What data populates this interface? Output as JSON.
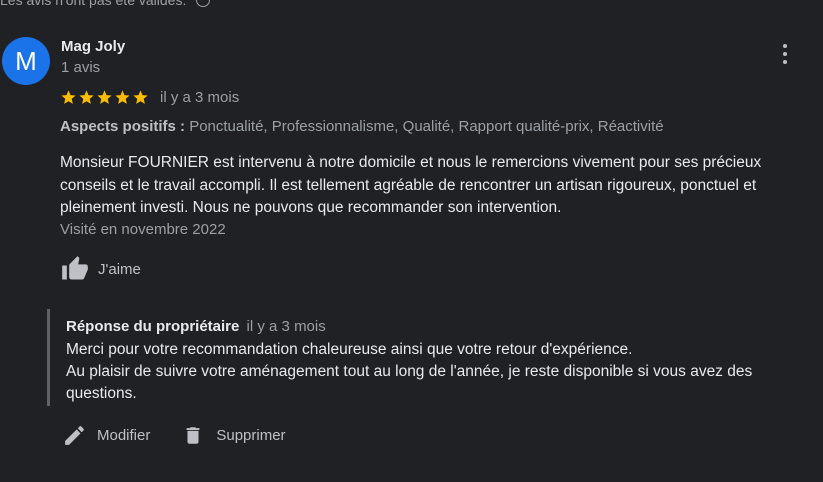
{
  "header_note": {
    "text": "Les avis n'ont pas été validés."
  },
  "review": {
    "author": {
      "initial": "M",
      "name": "Mag Joly",
      "meta": "1 avis",
      "avatar_color": "#1a73e8"
    },
    "rating": 5,
    "rating_max": 5,
    "date": "il y a 3 mois",
    "aspects": {
      "label": "Aspects positifs :",
      "values": "Ponctualité, Professionnalisme, Qualité, Rapport qualité-prix, Réactivité"
    },
    "text": "Monsieur FOURNIER est intervenu à notre domicile et nous le remercions vivement pour ses précieux conseils et le travail accompli. Il est tellement agréable de rencontrer un artisan rigoureux, ponctuel et pleinement investi. Nous ne pouvons que recommander son intervention.",
    "visited": "Visité en novembre 2022",
    "like_label": "J'aime"
  },
  "owner_reply": {
    "author": "Réponse du propriétaire",
    "date": "il y a 3 mois",
    "text_line1": "Merci pour votre recommandation chaleureuse ainsi que votre retour d'expérience.",
    "text_line2": "Au plaisir de suivre votre aménagement tout au long de l'année, je reste disponible si vous avez des questions."
  },
  "actions": {
    "edit_label": "Modifier",
    "delete_label": "Supprimer"
  },
  "icons": {
    "star": "star-icon",
    "like": "thumb-up-icon",
    "more": "more-vert-icon",
    "edit": "pencil-icon",
    "delete": "trash-icon",
    "info": "info-icon"
  },
  "colors": {
    "background": "#202124",
    "star": "#fbbc04",
    "text_primary": "#e8eaed",
    "text_secondary": "#9aa0a6"
  }
}
